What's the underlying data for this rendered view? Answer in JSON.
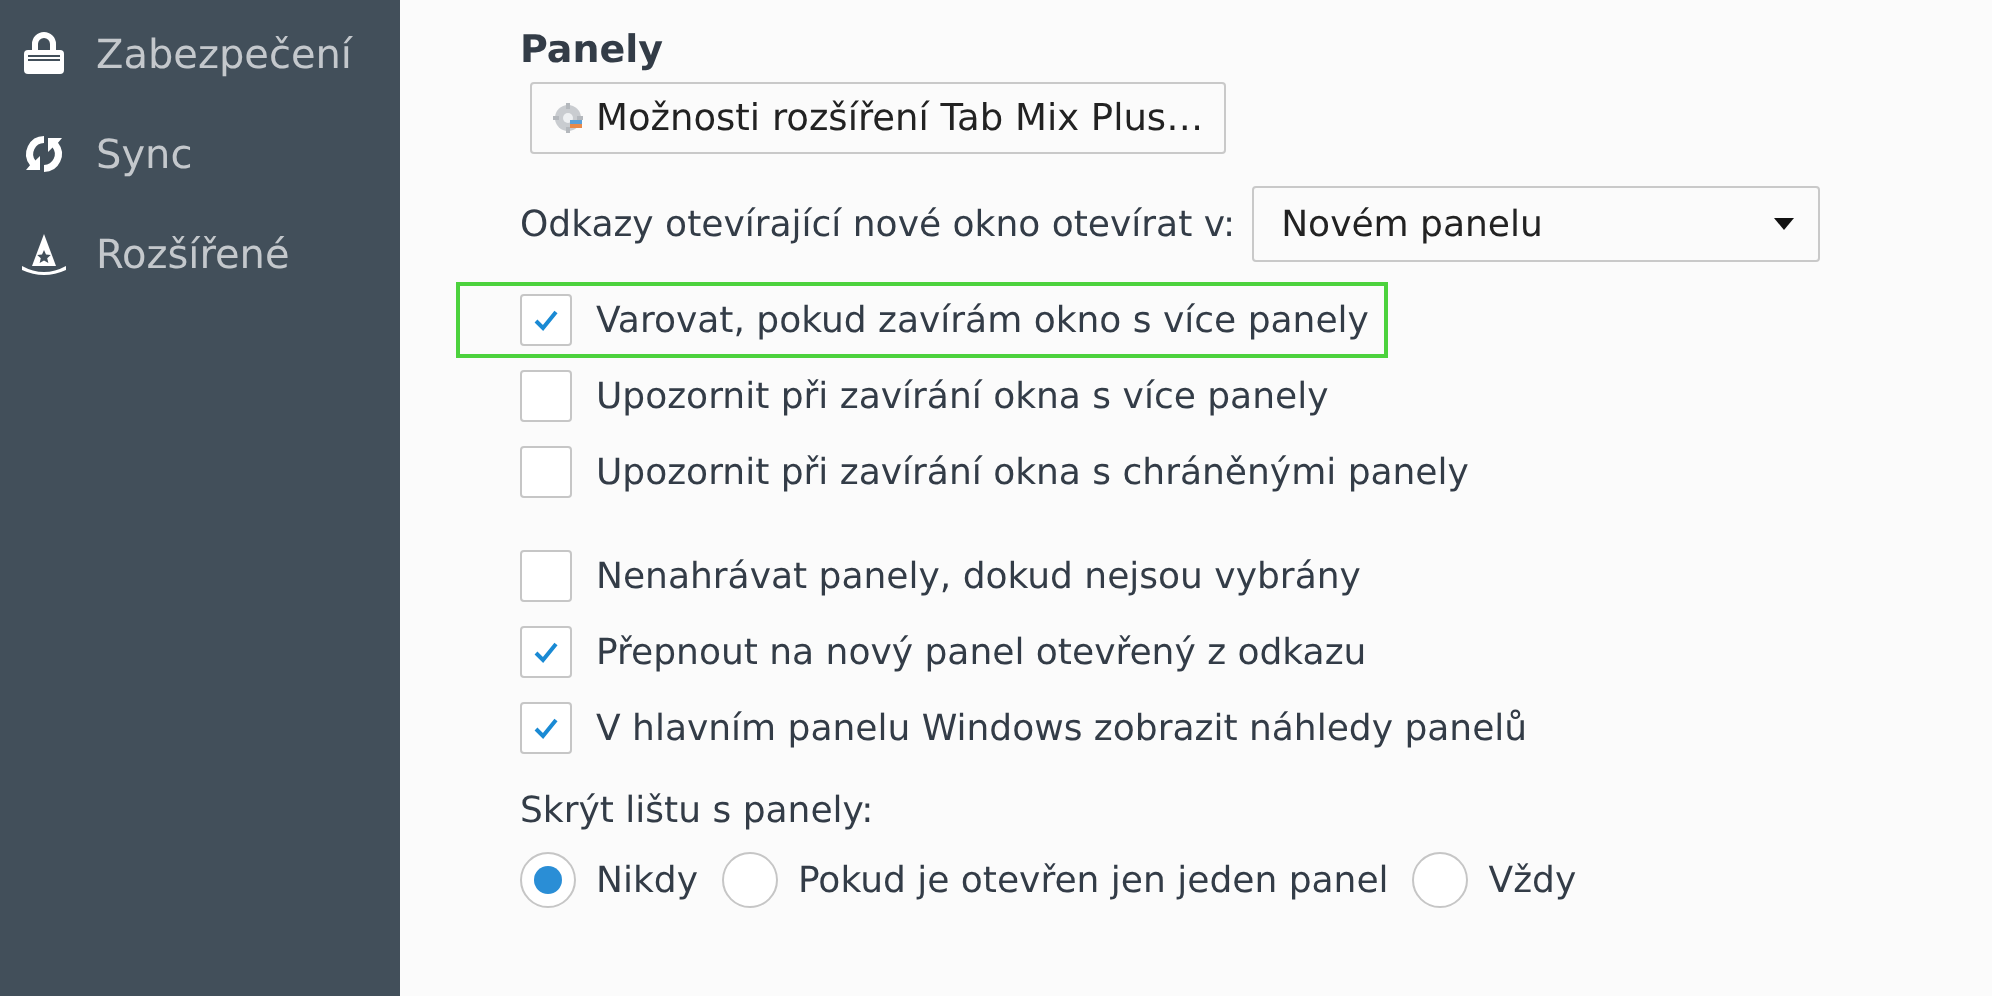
{
  "sidebar": {
    "items": [
      {
        "label": "Zabezpečení"
      },
      {
        "label": "Sync"
      },
      {
        "label": "Rozšířené"
      }
    ]
  },
  "section": {
    "title": "Panely",
    "extension_button": "Možnosti rozšíření Tab Mix Plus…",
    "open_links": {
      "label": "Odkazy otevírající nové okno otevírat v:",
      "value": "Novém panelu"
    },
    "checkbox_groups": [
      [
        {
          "label": "Varovat, pokud zavírám okno s více panely",
          "checked": true,
          "highlighted": true
        },
        {
          "label": "Upozornit při zavírání okna s více panely",
          "checked": false,
          "highlighted": false
        },
        {
          "label": "Upozornit při zavírání okna s chráněnými panely",
          "checked": false,
          "highlighted": false
        }
      ],
      [
        {
          "label": "Nenahrávat panely, dokud nejsou vybrány",
          "checked": false,
          "highlighted": false
        },
        {
          "label": "Přepnout na nový panel otevřený z odkazu",
          "checked": true,
          "highlighted": false
        },
        {
          "label": "V hlavním panelu Windows zobrazit náhledy panelů",
          "checked": true,
          "highlighted": false
        }
      ]
    ],
    "hide_tabbar": {
      "label": "Skrýt lištu s panely:",
      "options": [
        {
          "label": "Nikdy",
          "selected": true
        },
        {
          "label": "Pokud je otevřen jen jeden panel",
          "selected": false
        },
        {
          "label": "Vždy",
          "selected": false
        }
      ]
    }
  }
}
